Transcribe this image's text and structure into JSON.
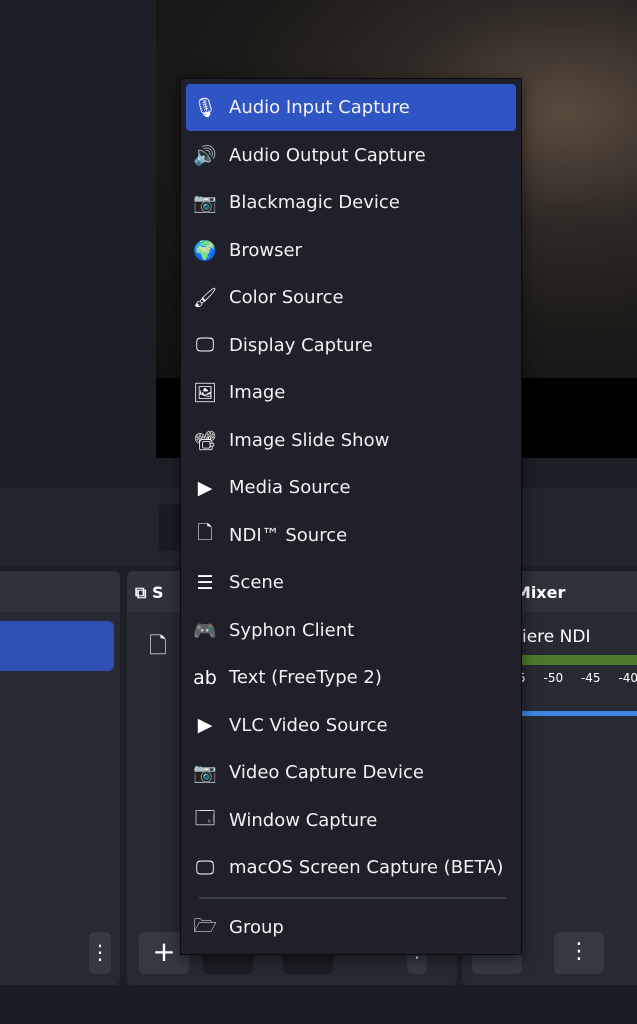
{
  "docks": {
    "sources_title_partial": "S",
    "mixer_title": "udio Mixer",
    "mixer_source": "iere NDI",
    "mixer_ticks": [
      "5",
      "-50",
      "-45",
      "-40"
    ]
  },
  "menu": {
    "items": [
      {
        "label": "Audio Input Capture",
        "icon": "microphone-icon",
        "glyph": "🎙"
      },
      {
        "label": "Audio Output Capture",
        "icon": "speaker-icon",
        "glyph": "🔊"
      },
      {
        "label": "Blackmagic Device",
        "icon": "camera-icon",
        "glyph": "📷"
      },
      {
        "label": "Browser",
        "icon": "globe-icon",
        "glyph": "🌍"
      },
      {
        "label": "Color Source",
        "icon": "paintbrush-icon",
        "glyph": "🖌"
      },
      {
        "label": "Display Capture",
        "icon": "monitor-icon",
        "glyph": "🖵"
      },
      {
        "label": "Image",
        "icon": "image-icon",
        "glyph": "🖼"
      },
      {
        "label": "Image Slide Show",
        "icon": "slideshow-icon",
        "glyph": "📽"
      },
      {
        "label": "Media Source",
        "icon": "play-icon",
        "glyph": "▶"
      },
      {
        "label": "NDI™ Source",
        "icon": "file-icon",
        "glyph": "🗋"
      },
      {
        "label": "Scene",
        "icon": "list-icon",
        "glyph": "☰"
      },
      {
        "label": "Syphon Client",
        "icon": "gamepad-icon",
        "glyph": "🎮"
      },
      {
        "label": "Text (FreeType 2)",
        "icon": "text-icon",
        "glyph": "ab"
      },
      {
        "label": "VLC Video Source",
        "icon": "play-icon",
        "glyph": "▶"
      },
      {
        "label": "Video Capture Device",
        "icon": "camera-icon",
        "glyph": "📷"
      },
      {
        "label": "Window Capture",
        "icon": "window-icon",
        "glyph": "🗔"
      },
      {
        "label": "macOS Screen Capture (BETA)",
        "icon": "monitor-icon",
        "glyph": "🖵"
      }
    ],
    "group": {
      "label": "Group",
      "icon": "folder-open-icon",
      "glyph": "🗁"
    }
  },
  "colors": {
    "highlight": "#2f55c4",
    "menu_bg": "#1f2029"
  }
}
